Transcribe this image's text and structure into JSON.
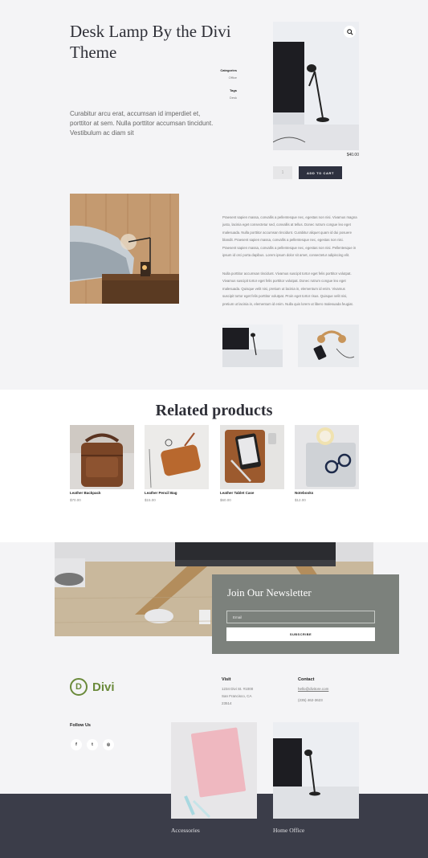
{
  "product": {
    "title": "Desk Lamp By the Divi Theme",
    "meta": {
      "categories_label": "Categories",
      "categories_value": "Office",
      "tags_label": "Tags",
      "tags_value": "Desk"
    },
    "short_description": "Curabitur arcu erat, accumsan id imperdiet et, porttitor at sem. Nulla porttitor accumsan tincidunt. Vestibulum ac diam sit",
    "price": "$40.00",
    "quantity": "1",
    "add_to_cart": "ADD TO CART",
    "zoom_icon": "search-icon",
    "description_p1": "Praesent sapien massa, convallis a pellentesque nec, egestas non nisi. Vivamus magna justo, lacinia eget consectetur sed, convallis at tellus. Donec rutrum congue leo eget malesuada. Nulla porttitor accumsan tincidunt. Curabitur aliquet quam id dui posuere blandit. Praesent sapien massa, convallis a pellentesque nec, egestas non nisi. Praesent sapien massa, convallis a pellentesque nec, egestas non nisi. Pellentesque in ipsum id orci porta dapibus. Lorem ipsum dolor sit amet, consectetur adipiscing elit.",
    "description_p2": "Nulla porttitor accumsan tincidunt. Vivamus suscipit tortor eget felis porttitor volutpat. Vivamus suscipit tortor eget felis porttitor volutpat. Donec rutrum congue leo eget malesuada. Quisque velit nisi, pretium ut lacinia in, elementum id enim. Vivamus suscipit tortor eget felis porttitor volutpat. Proin eget tortor risus. Quisque velit nisi, pretium ut lacinia in, elementum id enim. Nulla quis lorem ut libero malesuada feugiat."
  },
  "related": {
    "title": "Related products",
    "items": [
      {
        "name": "Leather Backpack",
        "price": "$70.00"
      },
      {
        "name": "Leather Pencil Bag",
        "price": "$15.00"
      },
      {
        "name": "Leather Tablet Case",
        "price": "$60.00"
      },
      {
        "name": "Notebooks",
        "price": "$12.00"
      }
    ]
  },
  "newsletter": {
    "title": "Join Our Newsletter",
    "email_placeholder": "Email",
    "subscribe": "SUBSCRIBE"
  },
  "footer": {
    "logo_letter": "D",
    "logo_text": "Divi",
    "visit_label": "Visit",
    "visit_lines": [
      "1234 Divi St. #1000",
      "San Francisco, CA",
      "23514"
    ],
    "contact_label": "Contact",
    "contact_email": "hello@divitore.com",
    "contact_phone": "(235) 462-3623",
    "follow_label": "Follow Us",
    "social": [
      {
        "icon": "facebook-icon",
        "glyph": "f"
      },
      {
        "icon": "twitter-icon",
        "glyph": "t"
      },
      {
        "icon": "instagram-icon",
        "glyph": "◎"
      }
    ],
    "categories": [
      "Accessories",
      "Home Office"
    ]
  },
  "colors": {
    "dark": "#3b3d49",
    "button": "#2e3140",
    "newsletter_bg": "#7c817c",
    "brand_green": "#6a8a3a"
  }
}
